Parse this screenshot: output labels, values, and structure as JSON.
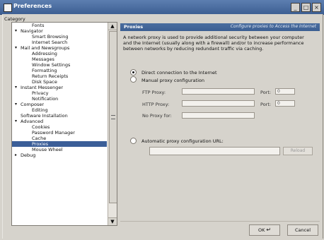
{
  "window": {
    "title": "Preferences",
    "buttons": [
      "_",
      "□",
      "×"
    ]
  },
  "category": {
    "label": "Category",
    "items": [
      {
        "label": "Fonts",
        "level": 1
      },
      {
        "label": "Navigator",
        "level": 0,
        "toggle": "▾"
      },
      {
        "label": "Smart Browsing",
        "level": 1
      },
      {
        "label": "Internet Search",
        "level": 1
      },
      {
        "label": "Mail and Newsgroups",
        "level": 0,
        "toggle": "▾"
      },
      {
        "label": "Addressing",
        "level": 1
      },
      {
        "label": "Messages",
        "level": 1
      },
      {
        "label": "Window Settings",
        "level": 1
      },
      {
        "label": "Formatting",
        "level": 1
      },
      {
        "label": "Return Receipts",
        "level": 1
      },
      {
        "label": "Disk Space",
        "level": 1
      },
      {
        "label": "Instant Messenger",
        "level": 0,
        "toggle": "▾"
      },
      {
        "label": "Privacy",
        "level": 1
      },
      {
        "label": "Notification",
        "level": 1
      },
      {
        "label": "Composer",
        "level": 0,
        "toggle": "▾"
      },
      {
        "label": "Editing",
        "level": 1
      },
      {
        "label": "Software Installation",
        "level": 0
      },
      {
        "label": "Advanced",
        "level": 0,
        "toggle": "▾"
      },
      {
        "label": "Cookies",
        "level": 1
      },
      {
        "label": "Password Manager",
        "level": 1
      },
      {
        "label": "Cache",
        "level": 1
      },
      {
        "label": "Proxies",
        "level": 1,
        "selected": true
      },
      {
        "label": "Mouse Wheel",
        "level": 1
      },
      {
        "label": "Debug",
        "level": 0,
        "toggle": "▸"
      }
    ],
    "scroll_up": "▲",
    "scroll_down": "▼"
  },
  "panel": {
    "title": "Proxies",
    "subtitle": "Configure proxies to Access the Internet",
    "description": "A network proxy is used to provide additional security between your computer and the Internet (usually along with a firewall) and/or to increase performance between networks by reducing redundant traffic via caching.",
    "direct_label": "Direct connection to the Internet",
    "manual_label": "Manual proxy configuration",
    "ftp_label": "FTP Proxy:",
    "http_label": "HTTP Proxy:",
    "noproxy_label": "No Proxy for:",
    "port_label": "Port:",
    "ftp_port": "0",
    "http_port": "0",
    "auto_label": "Automatic proxy configuration URL:",
    "reload_label": "Reload"
  },
  "buttons": {
    "ok": "OK",
    "cancel": "Cancel"
  }
}
